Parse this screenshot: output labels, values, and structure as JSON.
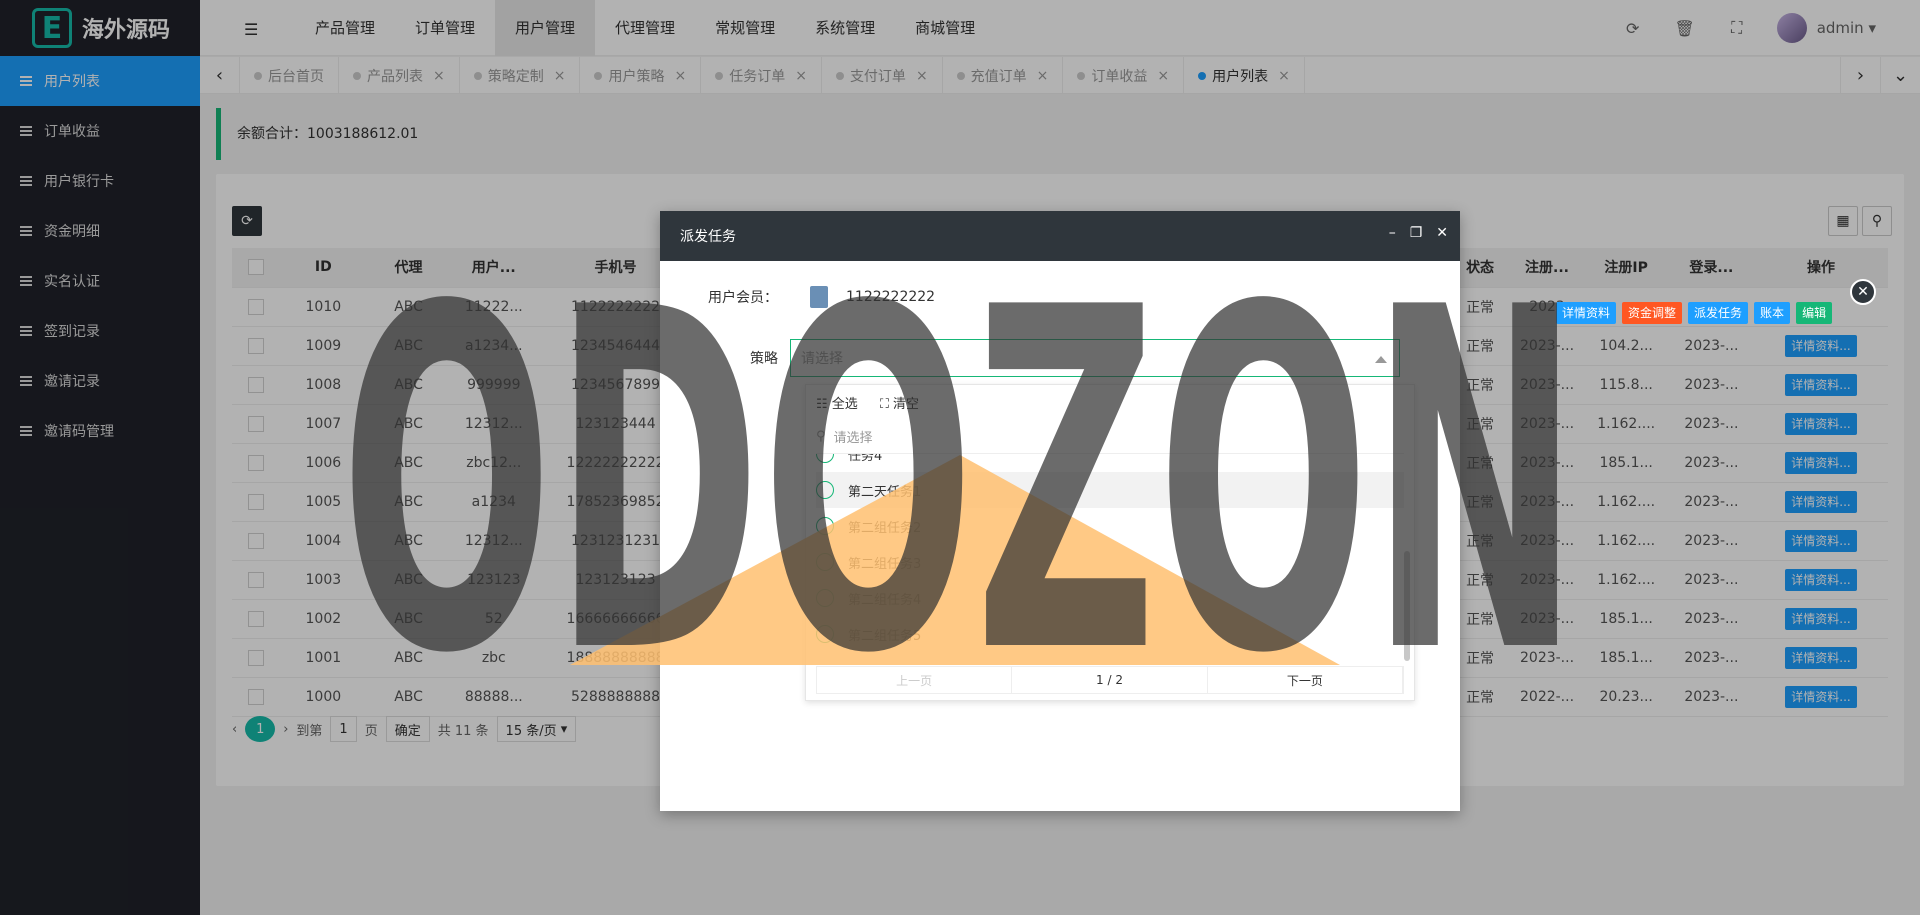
{
  "brand": {
    "logo_letter": "E",
    "name": "海外源码"
  },
  "sidebar": {
    "items": [
      {
        "label": "用户列表",
        "active": true
      },
      {
        "label": "订单收益"
      },
      {
        "label": "用户银行卡"
      },
      {
        "label": "资金明细"
      },
      {
        "label": "实名认证"
      },
      {
        "label": "签到记录"
      },
      {
        "label": "邀请记录"
      },
      {
        "label": "邀请码管理"
      }
    ]
  },
  "header": {
    "menus": [
      "产品管理",
      "订单管理",
      "用户管理",
      "代理管理",
      "常规管理",
      "系统管理",
      "商城管理"
    ],
    "active_menu": "用户管理",
    "user": "admin"
  },
  "tabs": [
    {
      "label": "后台首页",
      "closable": false
    },
    {
      "label": "产品列表",
      "closable": true
    },
    {
      "label": "策略定制",
      "closable": true
    },
    {
      "label": "用户策略",
      "closable": true
    },
    {
      "label": "任务订单",
      "closable": true
    },
    {
      "label": "支付订单",
      "closable": true
    },
    {
      "label": "充值订单",
      "closable": true
    },
    {
      "label": "订单收益",
      "closable": true
    },
    {
      "label": "用户列表",
      "closable": true,
      "active": true
    }
  ],
  "balance": {
    "label": "余额合计：",
    "value": "1003188612.01"
  },
  "table": {
    "columns": [
      "ID",
      "代理",
      "用户...",
      "手机号",
      "状态",
      "注册...",
      "注册IP",
      "登录...",
      "操作"
    ],
    "rows": [
      {
        "id": "1010",
        "agent": "ABC",
        "user": "11222...",
        "phone": "1122222222",
        "status": "正常",
        "reg": "2023",
        "ip": "",
        "login": ""
      },
      {
        "id": "1009",
        "agent": "ABC",
        "user": "a1234...",
        "phone": "1234546444",
        "status": "正常",
        "reg": "2023-...",
        "ip": "104.2...",
        "login": "2023-..."
      },
      {
        "id": "1008",
        "agent": "ABC",
        "user": "999999",
        "phone": "1234567899",
        "status": "正常",
        "reg": "2023-...",
        "ip": "115.8...",
        "login": "2023-..."
      },
      {
        "id": "1007",
        "agent": "ABC",
        "user": "12312...",
        "phone": "123123444",
        "status": "正常",
        "reg": "2023-...",
        "ip": "1.162....",
        "login": "2023-..."
      },
      {
        "id": "1006",
        "agent": "ABC",
        "user": "zbc12...",
        "phone": "12222222222",
        "status": "正常",
        "reg": "2023-...",
        "ip": "185.1...",
        "login": "2023-..."
      },
      {
        "id": "1005",
        "agent": "ABC",
        "user": "a1234",
        "phone": "17852369852",
        "status": "正常",
        "reg": "2023-...",
        "ip": "1.162....",
        "login": "2023-..."
      },
      {
        "id": "1004",
        "agent": "ABC",
        "user": "12312...",
        "phone": "1231231231",
        "status": "正常",
        "reg": "2023-...",
        "ip": "1.162....",
        "login": "2023-..."
      },
      {
        "id": "1003",
        "agent": "ABC",
        "user": "123123",
        "phone": "123123123",
        "status": "正常",
        "reg": "2023-...",
        "ip": "1.162....",
        "login": "2023-..."
      },
      {
        "id": "1002",
        "agent": "ABC",
        "user": "52",
        "phone": "16666666666",
        "status": "正常",
        "reg": "2023-...",
        "ip": "185.1...",
        "login": "2023-..."
      },
      {
        "id": "1001",
        "agent": "ABC",
        "user": "zbc",
        "phone": "18888888888",
        "status": "正常",
        "reg": "2023-...",
        "ip": "185.1...",
        "login": "2023-..."
      },
      {
        "id": "1000",
        "agent": "ABC",
        "user": "88888...",
        "phone": "5288888888",
        "status": "正常",
        "reg": "2022-...",
        "ip": "20.23...",
        "login": "2023-..."
      }
    ],
    "detail_btn": "详情资料...",
    "row_ops": [
      "详情资料",
      "资金调整",
      "派发任务",
      "账本",
      "编辑"
    ]
  },
  "pager": {
    "page": "1",
    "goto": "到第",
    "goto_val": "1",
    "unit": "页",
    "confirm": "确定",
    "total": "共 11 条",
    "size": "15 条/页"
  },
  "dialog": {
    "title": "派发任务",
    "member_label": "用户会员：",
    "member_value": "1122222222",
    "strategy_label": "策略",
    "placeholder": "请选择",
    "select_all": "全选",
    "clear": "清空",
    "search_placeholder": "请选择",
    "options": [
      "任务4",
      "第二天任务1",
      "第二组任务2",
      "第二组任务3",
      "第二组任务4",
      "第二组任务5"
    ],
    "prev": "上一页",
    "page": "1 / 2",
    "next": "下一页"
  },
  "watermark": "ODOZON"
}
